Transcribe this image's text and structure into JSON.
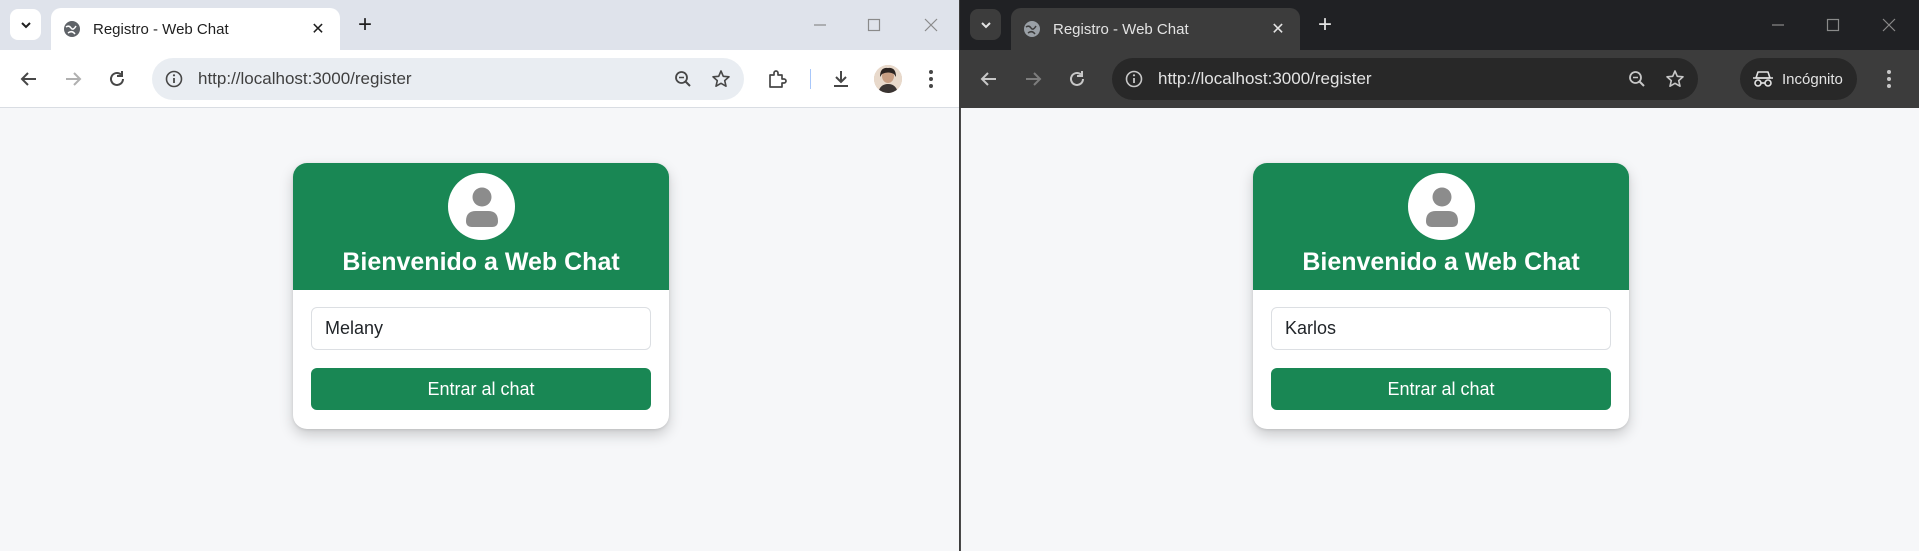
{
  "colors": {
    "accent": "#198754",
    "page_bg": "#f6f7f9",
    "light_chrome": "#dfe3eb",
    "dark_chrome": "#202124"
  },
  "windows": [
    {
      "theme": "light",
      "tab": {
        "title": "Registro - Web Chat",
        "favicon": "globe-icon"
      },
      "address": {
        "url": "http://localhost:3000/register"
      },
      "profile": "avatar-photo",
      "card": {
        "title": "Bienvenido a Web Chat",
        "avatar_icon": "user-icon",
        "input_value": "Melany",
        "button_label": "Entrar al chat"
      }
    },
    {
      "theme": "dark",
      "tab": {
        "title": "Registro - Web Chat",
        "favicon": "globe-icon"
      },
      "address": {
        "url": "http://localhost:3000/register"
      },
      "incognito_label": "Incógnito",
      "card": {
        "title": "Bienvenido a Web Chat",
        "avatar_icon": "user-icon",
        "input_value": "Karlos",
        "button_label": "Entrar al chat"
      }
    }
  ]
}
